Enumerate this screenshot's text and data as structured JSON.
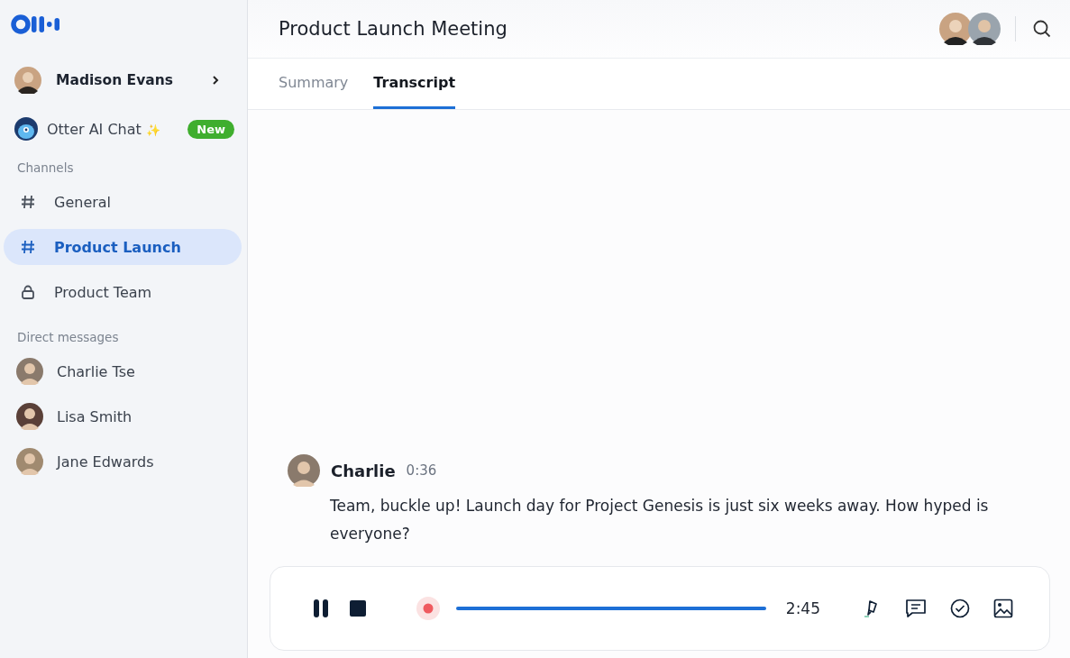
{
  "user": {
    "name": "Madison Evans"
  },
  "ai_chat": {
    "label": "Otter AI Chat",
    "sparkle": "✨",
    "badge": "New"
  },
  "channels": {
    "heading": "Channels",
    "items": [
      {
        "label": "General",
        "kind": "hash",
        "selected": false
      },
      {
        "label": "Product Launch",
        "kind": "hash",
        "selected": true
      },
      {
        "label": "Product Team",
        "kind": "lock",
        "selected": false
      }
    ]
  },
  "direct_messages": {
    "heading": "Direct messages",
    "items": [
      {
        "label": "Charlie Tse",
        "color": "#8a7a6c"
      },
      {
        "label": "Lisa Smith",
        "color": "#5a4038"
      },
      {
        "label": "Jane Edwards",
        "color": "#a08a70"
      }
    ]
  },
  "header": {
    "title": "Product Launch Meeting"
  },
  "tabs": [
    {
      "label": "Summary",
      "selected": false
    },
    {
      "label": "Transcript",
      "selected": true
    }
  ],
  "message": {
    "speaker": "Charlie",
    "time": "0:36",
    "text": "Team, buckle up! Launch day for Project Genesis is just six weeks away. How hyped is everyone?"
  },
  "player": {
    "elapsed": "2:45",
    "paused": false
  }
}
